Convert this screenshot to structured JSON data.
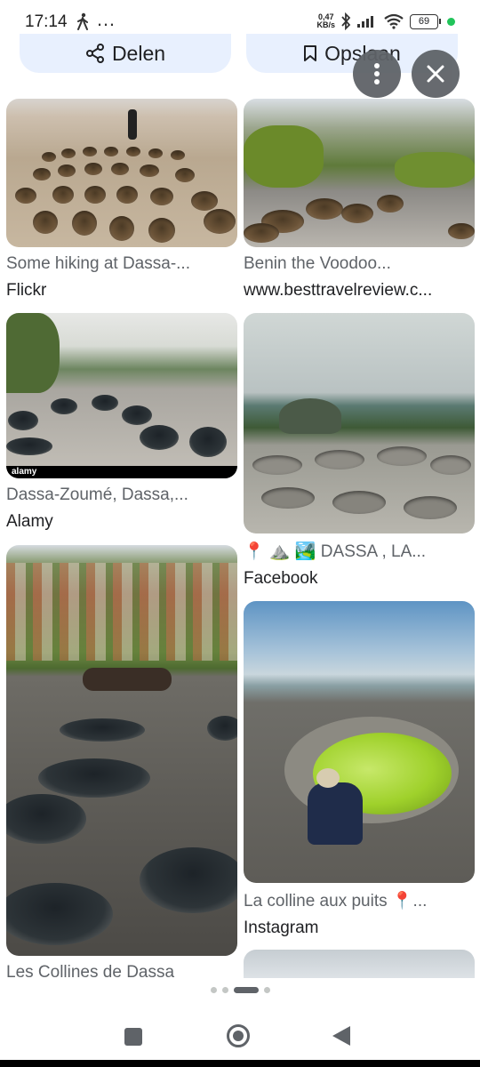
{
  "status_bar": {
    "time": "17:14",
    "overflow_icon": "…",
    "network_speed_value": "0,47",
    "network_speed_unit": "KB/s",
    "battery": "69"
  },
  "actions": {
    "share_label": "Delen",
    "save_label": "Opslaan"
  },
  "results": [
    {
      "title": "Some hiking at Dassa-...",
      "source": "Flickr"
    },
    {
      "title": "Benin the Voodoo...",
      "source": "www.besttravelreview.c..."
    },
    {
      "title": "Dassa-Zoumé, Dassa,...",
      "source": "Alamy"
    },
    {
      "title": "📍 ⛰️ 🏞️ DASSA , LA...",
      "source": "Facebook"
    },
    {
      "title": "Les Collines de Dassa",
      "source": ""
    },
    {
      "title": "La colline aux puits 📍...",
      "source": "Instagram"
    }
  ],
  "watermark": "alamy",
  "colors": {
    "accent_button_bg": "#e8f0fe",
    "fab_bg": "#5f6368",
    "status_dot": "#21c45a"
  },
  "icons": {
    "share": "share-icon",
    "save": "bookmark-icon",
    "more": "more-vert-icon",
    "close": "close-icon"
  },
  "pager": {
    "active_index": 2,
    "count": 4
  }
}
